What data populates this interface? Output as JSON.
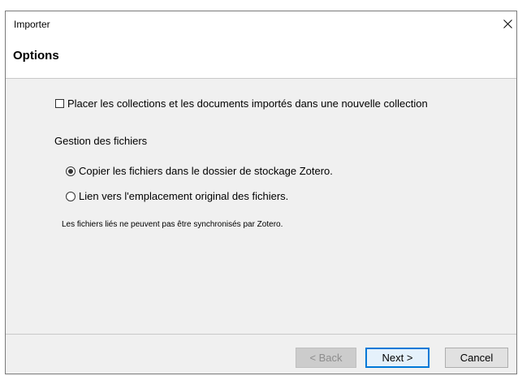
{
  "window": {
    "title": "Importer"
  },
  "page": {
    "title": "Options"
  },
  "options": {
    "new_collection_checkbox": {
      "label": "Placer les collections et les documents importés dans une nouvelle collection",
      "checked": false
    },
    "file_handling": {
      "heading": "Gestion des fichiers",
      "choices": [
        {
          "label": "Copier les fichiers dans le dossier de stockage Zotero.",
          "selected": true
        },
        {
          "label": "Lien vers l'emplacement original des fichiers.",
          "selected": false
        }
      ],
      "note": "Les fichiers liés ne peuvent pas être synchronisés par Zotero."
    }
  },
  "buttons": {
    "back_label": "< Back",
    "next_label": "Next >",
    "cancel_label": "Cancel"
  },
  "colors": {
    "accent": "#0078d7",
    "dialog_bg": "#f0f0f0"
  }
}
